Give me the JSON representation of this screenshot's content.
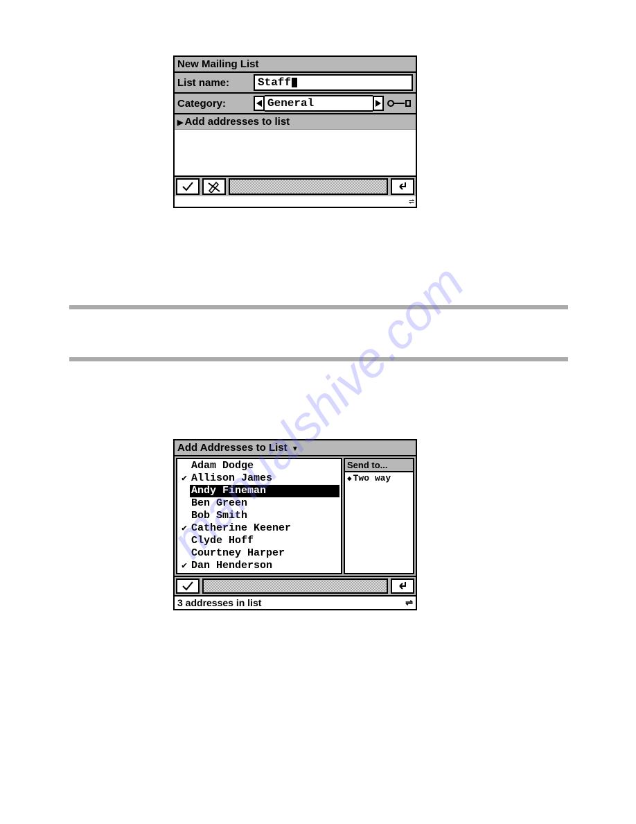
{
  "watermark_text": "manualshive.com",
  "win1": {
    "title": "New Mailing List",
    "list_name_label": "List name:",
    "list_name_value": "Staff",
    "category_label": "Category:",
    "category_value": "General",
    "section_header": "Add addresses to list"
  },
  "win2": {
    "title": "Add Addresses to List",
    "send_to_header": "Send to...",
    "send_to_option": "Two way",
    "addresses": [
      {
        "name": "Adam Dodge",
        "checked": false,
        "selected": false
      },
      {
        "name": "Allison James",
        "checked": true,
        "selected": false
      },
      {
        "name": "Andy Fineman",
        "checked": false,
        "selected": true
      },
      {
        "name": "Ben Green",
        "checked": false,
        "selected": false
      },
      {
        "name": "Bob Smith",
        "checked": false,
        "selected": false
      },
      {
        "name": "Catherine Keener",
        "checked": true,
        "selected": false
      },
      {
        "name": "Clyde Hoff",
        "checked": false,
        "selected": false
      },
      {
        "name": "Courtney Harper",
        "checked": false,
        "selected": false
      },
      {
        "name": "Dan Henderson",
        "checked": true,
        "selected": false
      }
    ],
    "status": "3 addresses in list"
  }
}
